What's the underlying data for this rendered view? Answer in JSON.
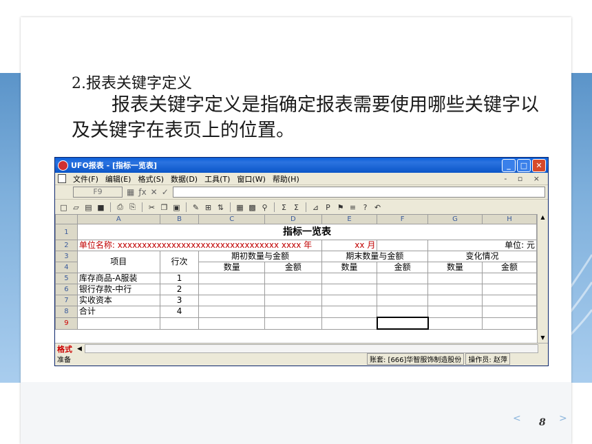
{
  "slide": {
    "heading": "2.报表关键字定义",
    "paragraph": "报表关键字定义是指确定报表需要使用哪些关键字以及关键字在表页上的位置。",
    "page_number": "8",
    "prev": "<",
    "next": ">"
  },
  "window": {
    "title": "UFO报表 - [指标一览表]",
    "menu": [
      "文件(F)",
      "编辑(E)",
      "格式(S)",
      "数据(D)",
      "工具(T)",
      "窗口(W)",
      "帮助(H)"
    ],
    "mdi_controls": "- ▫ ×",
    "cell_ref": "F9",
    "columns": [
      "A",
      "B",
      "C",
      "D",
      "E",
      "F",
      "G",
      "H"
    ],
    "rows": [
      {
        "n": "1",
        "title": "指标一览表"
      },
      {
        "n": "2",
        "unit_name": "单位名称: xxxxxxxxxxxxxxxxxxxxxxxxxxxxxxxxx  xxxx 年",
        "month": "xx 月",
        "unit": "单位: 元"
      },
      {
        "n": "3",
        "item": "项目",
        "line": "行次",
        "begin": "期初数量与金额",
        "end": "期末数量与金额",
        "change": "变化情况"
      },
      {
        "n": "4",
        "qty1": "数量",
        "amt1": "金额",
        "qty2": "数量",
        "amt2": "金额",
        "qty3": "数量",
        "amt3": "金额"
      },
      {
        "n": "5",
        "item": "库存商品-A服装",
        "line": "1"
      },
      {
        "n": "6",
        "item": "银行存款-中行",
        "line": "2"
      },
      {
        "n": "7",
        "item": "实收资本",
        "line": "3"
      },
      {
        "n": "8",
        "item": "合计",
        "line": "4"
      },
      {
        "n": "9"
      }
    ],
    "mode": "格式",
    "status_ready": "准备",
    "status_account": "账套: [666]华智服饰制造股份",
    "status_operator": "操作员: 赵萍"
  },
  "colors": {
    "accent_red": "#c00000",
    "title_blue": "#0a5fd8"
  }
}
